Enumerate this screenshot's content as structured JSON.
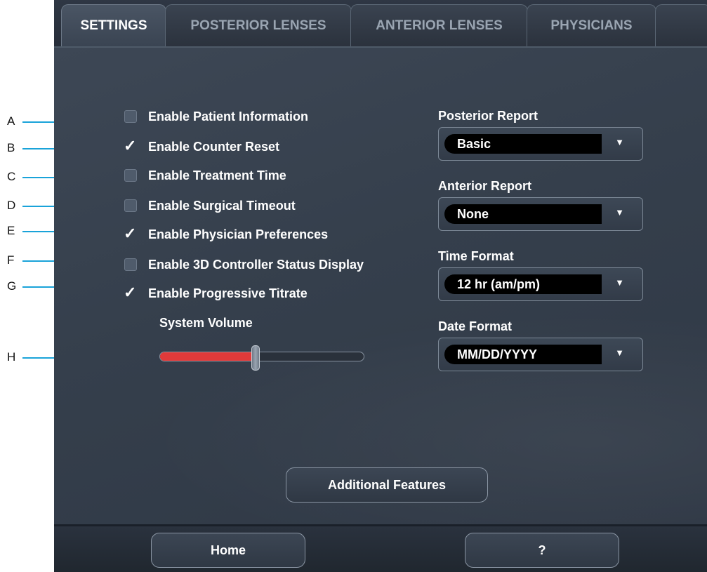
{
  "tabs": [
    {
      "label": "SETTINGS",
      "active": true
    },
    {
      "label": "POSTERIOR LENSES",
      "active": false
    },
    {
      "label": "ANTERIOR LENSES",
      "active": false
    },
    {
      "label": "PHYSICIANS",
      "active": false
    },
    {
      "label": "",
      "active": false
    }
  ],
  "callouts": [
    "A",
    "B",
    "C",
    "D",
    "E",
    "F",
    "G",
    "H"
  ],
  "options": [
    {
      "label": "Enable Patient Information",
      "checked": false
    },
    {
      "label": "Enable Counter Reset",
      "checked": true
    },
    {
      "label": "Enable Treatment Time",
      "checked": false
    },
    {
      "label": "Enable Surgical Timeout",
      "checked": false
    },
    {
      "label": "Enable Physician Preferences",
      "checked": true
    },
    {
      "label": "Enable 3D Controller Status Display",
      "checked": false
    },
    {
      "label": "Enable Progressive Titrate",
      "checked": true
    }
  ],
  "volume": {
    "label": "System Volume",
    "level": 0.47,
    "fill_color": "#e03a3a"
  },
  "dropdowns": [
    {
      "label": "Posterior Report",
      "value": "Basic"
    },
    {
      "label": "Anterior Report",
      "value": "None"
    },
    {
      "label": "Time Format",
      "value": "12 hr (am/pm)"
    },
    {
      "label": "Date Format",
      "value": "MM/DD/YYYY"
    }
  ],
  "dropdown_arrow": "▼",
  "checkmark": "✓",
  "buttons": {
    "additional": "Additional Features",
    "home": "Home",
    "help": "?"
  },
  "colors": {
    "callout_line": "#1aa3d9",
    "panel_bg": "#353f4c"
  }
}
